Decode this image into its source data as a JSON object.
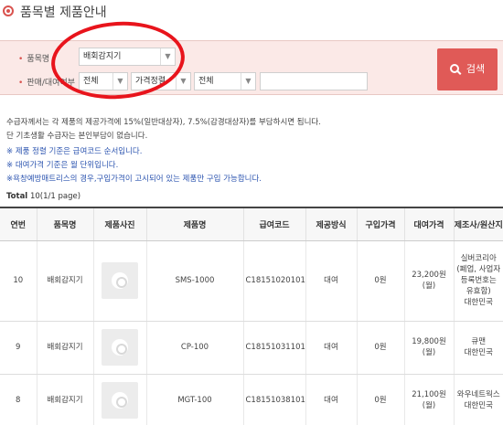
{
  "header": {
    "title": "품목별 제품안내"
  },
  "search": {
    "item_label": "품목명",
    "item_value": "배회감지기",
    "sale_label": "판매/대여여부",
    "sale_value": "전체",
    "sort_value": "가격정렬",
    "type_value": "전체",
    "text_value": "",
    "button_label": "검색"
  },
  "notices": {
    "line1": "수급자께서는 각 제품의 제공가격에 15%(일반대상자), 7.5%(감경대상자)를 부담하시면 됩니다.",
    "line2": "단 기초생활 수급자는 본인부담이 없습니다.",
    "line3": "※ 제품 정렬 기준은 급여코드 순서입니다.",
    "line4": "※ 대여가격 기준은 월 단위입니다.",
    "line5": "※욕창예방매트리스의 경우,구입가격이 고시되어 있는 제품만 구입 가능합니다."
  },
  "total": {
    "label": "Total",
    "count": "10",
    "pages": "(1/1 page)"
  },
  "table": {
    "headers": [
      "연번",
      "품목명",
      "제품사진",
      "제품명",
      "급여코드",
      "제공방식",
      "구입가격",
      "대여가격",
      "제조사/원산지"
    ],
    "rows": [
      {
        "no": "10",
        "item": "배회감지기",
        "name": "SMS-1000",
        "code": "C18151020101",
        "method": "대여",
        "buy": "0원",
        "rent": "23,200원(월)",
        "maker": "실버코리아(폐업, 사업자등록번호는 유효함)",
        "origin": "대한민국"
      },
      {
        "no": "9",
        "item": "배회감지기",
        "name": "CP-100",
        "code": "C18151031101",
        "method": "대여",
        "buy": "0원",
        "rent": "19,800원(월)",
        "maker": "큐맨",
        "origin": "대한민국"
      },
      {
        "no": "8",
        "item": "배회감지기",
        "name": "MGT-100",
        "code": "C18151038101",
        "method": "대여",
        "buy": "0원",
        "rent": "21,100원(월)",
        "maker": "와우네트웍스",
        "origin": "대한민국"
      }
    ]
  },
  "colors": {
    "accent": "#e05a57",
    "panel_bg": "#fbe9e7",
    "annotation": "#e8141c",
    "notice_blue": "#2d55b0"
  }
}
